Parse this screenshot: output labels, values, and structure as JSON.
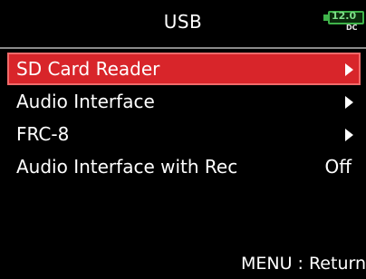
{
  "header": {
    "title": "USB",
    "battery": {
      "voltage": "12.0",
      "source": "DC",
      "color": "#3fb34a"
    }
  },
  "menu": {
    "items": [
      {
        "label": "SD Card Reader",
        "selected": true
      },
      {
        "label": "Audio Interface"
      },
      {
        "label": "FRC-8"
      },
      {
        "label": "Audio Interface with Rec",
        "value": "Off"
      }
    ],
    "selected_color": "#d8252a"
  },
  "footer": {
    "hint": "MENU : Return"
  }
}
